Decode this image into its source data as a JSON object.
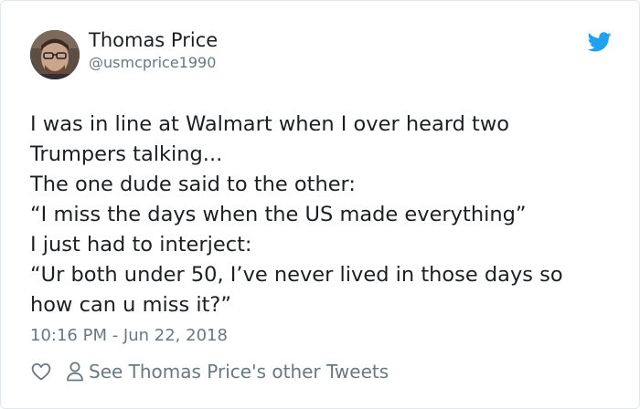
{
  "author": {
    "display_name": "Thomas Price",
    "handle": "@usmcprice1990"
  },
  "tweet": {
    "lines": [
      "I was in line at Walmart when I over heard two",
      "Trumpers talking...",
      "The one dude said to the other:",
      "“I miss the days when the US made everything”",
      "I just had to interject:",
      "“Ur both under 50, I’ve never lived in those days so",
      "how can u miss it?”"
    ],
    "timestamp": "10:16 PM - Jun 22, 2018"
  },
  "actions": {
    "like_icon": "heart-icon",
    "other_tweets_icon": "person-icon",
    "other_tweets_label": "See Thomas Price's other Tweets"
  },
  "colors": {
    "twitter_blue": "#1da1f2",
    "text": "#1c2022",
    "muted": "#697882"
  }
}
